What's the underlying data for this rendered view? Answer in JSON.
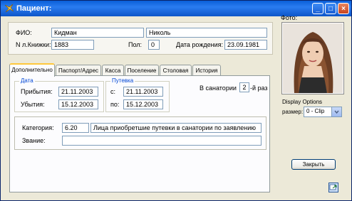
{
  "window": {
    "title": "Пациент:",
    "minimize": "_",
    "maximize": "□",
    "close": "×"
  },
  "header": {
    "fio_label": "ФИО:",
    "last_name": "Кидман",
    "first_name": "Николь",
    "card_label": "N л.Книжки:",
    "card_number": "1883",
    "sex_label": "Пол:",
    "sex_value": "0",
    "birth_label": "Дата рождения:",
    "birth_date": "23.09.1981"
  },
  "tabs": [
    {
      "label": "Дополнительно"
    },
    {
      "label": "Паспорт/Адрес"
    },
    {
      "label": "Касса"
    },
    {
      "label": "Поселение"
    },
    {
      "label": "Столовая"
    },
    {
      "label": "История"
    }
  ],
  "dates_group": {
    "legend": "Дата",
    "arrival_label": "Прибытия:",
    "arrival_value": "21.11.2003",
    "departure_label": "Убытия:",
    "departure_value": "15.12.2003"
  },
  "voucher_group": {
    "legend": "Путевка",
    "from_label": "с:",
    "from_value": "21.11.2003",
    "to_label": "по:",
    "to_value": "15.12.2003"
  },
  "sanatorium": {
    "label_before": "В санатории",
    "value": "2",
    "label_after": "-й раз"
  },
  "category": {
    "label": "Категория:",
    "code": "6.20",
    "description": "Лица приобретшие путевки в санатории по заявлению",
    "rank_label": "Звание:",
    "rank_value": ""
  },
  "photo": {
    "label": "Фото:",
    "display_options_label": "Display Options",
    "size_label": "размер:",
    "size_value": "0 - Clip"
  },
  "buttons": {
    "close_label": "Закрыть"
  },
  "colors": {
    "titlebar": "#0a5fd8",
    "legend_text": "#0046d5",
    "tab_active_accent": "#ffc83c"
  }
}
